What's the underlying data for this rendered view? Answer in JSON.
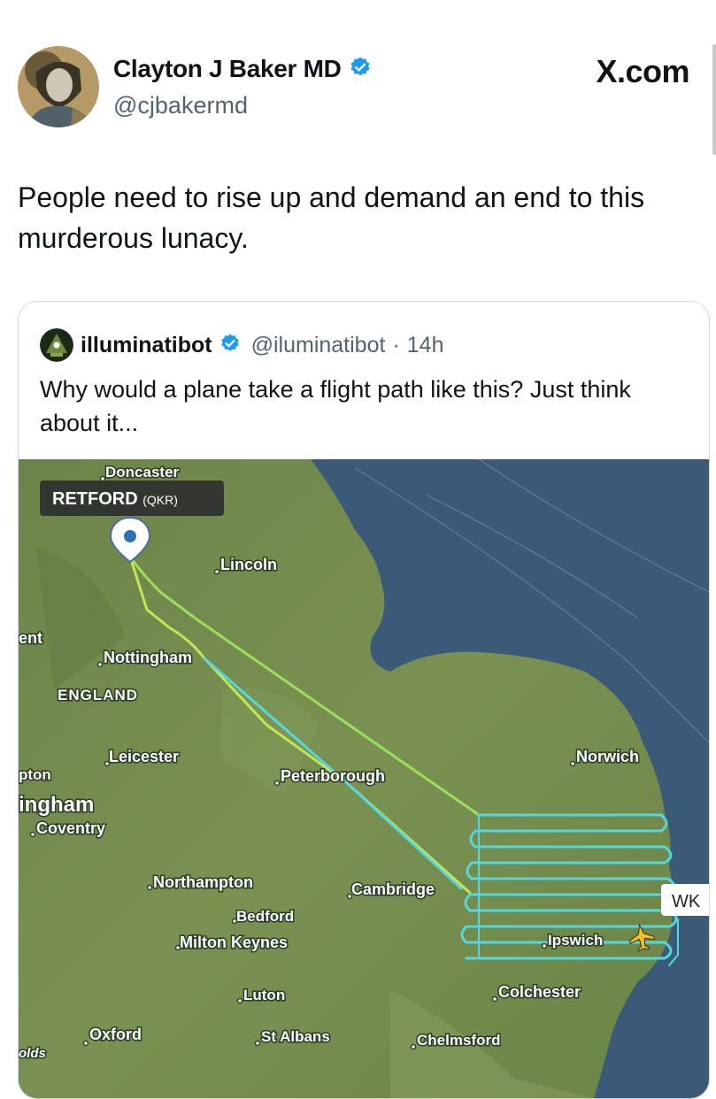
{
  "post": {
    "author_name": "Clayton J Baker MD",
    "author_handle": "@cjbakermd",
    "brand": "X.com",
    "text": "People need to rise up and demand an end to this murderous lunacy."
  },
  "quote": {
    "author_name": "illuminatibot",
    "author_handle": "@iluminatibot",
    "separator": "·",
    "time": "14h",
    "text": "Why would a plane take a flight path like this? Just think about it..."
  },
  "map": {
    "origin_label": "RETFORD",
    "origin_code": "(QKR)",
    "aircraft_tag": "WK",
    "places": {
      "doncaster": "Doncaster",
      "lincoln": "Lincoln",
      "nottingham": "Nottingham",
      "england": "ENGLAND",
      "leicester": "Leicester",
      "peterborough": "Peterborough",
      "norwich": "Norwich",
      "coventry": "Coventry",
      "northampton": "Northampton",
      "cambridge": "Cambridge",
      "bedford": "Bedford",
      "milton_keynes": "Milton Keynes",
      "ipswich": "Ipswich",
      "luton": "Luton",
      "colchester": "Colchester",
      "oxford": "Oxford",
      "st_albans": "St Albans",
      "chelmsford": "Chelmsford",
      "ent_partial": "ent",
      "pton_partial": "pton",
      "ingham_partial": "ingham",
      "olds_partial": "olds"
    },
    "colors": {
      "sea": "#3b5a78",
      "land": "#6f8a4e",
      "track_green": "#9be05a",
      "track_cyan": "#56d6dd"
    }
  },
  "colors": {
    "verified": "#1d9bf0",
    "muted_text": "#536471"
  },
  "icons": {
    "verified": "verified-badge-icon",
    "location_pin": "location-pin-icon",
    "aircraft": "aircraft-icon"
  }
}
